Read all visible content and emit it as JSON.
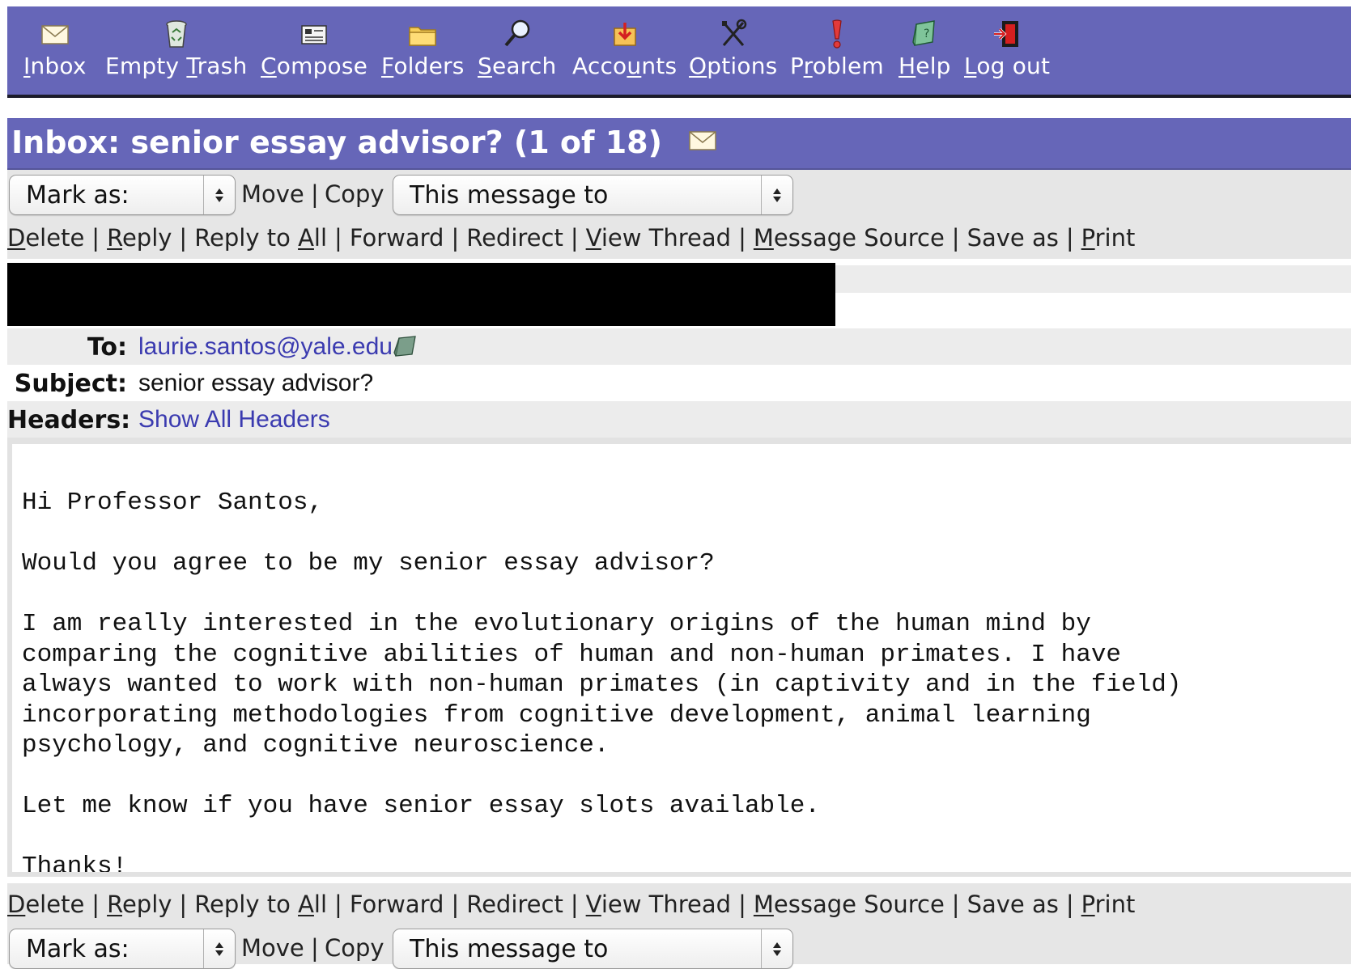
{
  "toolbar": {
    "items": [
      {
        "label_pre": "",
        "label_u": "I",
        "label_post": "nbox",
        "icon": "envelope-icon"
      },
      {
        "label_pre": "Empty ",
        "label_u": "T",
        "label_post": "rash",
        "icon": "recycle-bin-icon"
      },
      {
        "label_pre": "",
        "label_u": "C",
        "label_post": "ompose",
        "icon": "compose-card-icon"
      },
      {
        "label_pre": "",
        "label_u": "F",
        "label_post": "olders",
        "icon": "folder-icon"
      },
      {
        "label_pre": "",
        "label_u": "S",
        "label_post": "earch",
        "icon": "magnifier-icon"
      },
      {
        "label_pre": "Acco",
        "label_u": "u",
        "label_post": "nts",
        "icon": "accounts-box-icon"
      },
      {
        "label_pre": "",
        "label_u": "O",
        "label_post": "ptions",
        "icon": "tools-icon"
      },
      {
        "label_pre": "P",
        "label_u": "r",
        "label_post": "oblem",
        "icon": "exclamation-icon"
      },
      {
        "label_pre": "",
        "label_u": "H",
        "label_post": "elp",
        "icon": "help-book-icon"
      },
      {
        "label_pre": "",
        "label_u": "L",
        "label_post": "og out",
        "icon": "logout-door-icon"
      }
    ]
  },
  "title": {
    "text": "Inbox: senior essay advisor? (1 of 18)",
    "icon": "envelope-icon"
  },
  "controls": {
    "mark_as": "Mark as:",
    "move": "Move",
    "copy": "Copy",
    "sep": "|",
    "message_to": "This message to"
  },
  "actions": [
    {
      "pre": "",
      "u": "D",
      "post": "elete"
    },
    {
      "pre": "",
      "u": "R",
      "post": "eply"
    },
    {
      "pre": "Reply to ",
      "u": "A",
      "post": "ll"
    },
    {
      "pre": "Forward",
      "u": "",
      "post": ""
    },
    {
      "pre": "Redirect",
      "u": "",
      "post": ""
    },
    {
      "pre": "",
      "u": "V",
      "post": "iew Thread"
    },
    {
      "pre": "",
      "u": "M",
      "post": "essage Source"
    },
    {
      "pre": "Save as",
      "u": "",
      "post": ""
    },
    {
      "pre": "",
      "u": "P",
      "post": "rint"
    }
  ],
  "headers": {
    "to_label": "To:",
    "to_value": "laurie.santos@yale.edu",
    "subject_label": "Subject:",
    "subject_value": "senior essay advisor?",
    "headers_label": "Headers:",
    "headers_value": "Show All Headers"
  },
  "message": {
    "lines": [
      "Hi Professor Santos,",
      "",
      "Would you agree to be my senior essay advisor?",
      "",
      "I am really interested in the evolutionary origins of the human mind by",
      "comparing the cognitive abilities of human and non-human primates. I have",
      "always wanted to work with non-human primates (in captivity and in the field)",
      "incorporating methodologies from cognitive development, animal learning",
      "psychology, and cognitive neuroscience.",
      "",
      "Let me know if you have senior essay slots available.",
      "",
      "Thanks!"
    ]
  },
  "colors": {
    "toolbar_bg": "#6666b8",
    "link_blue": "#3b3bb0",
    "row_gray": "#e6e6e6"
  }
}
